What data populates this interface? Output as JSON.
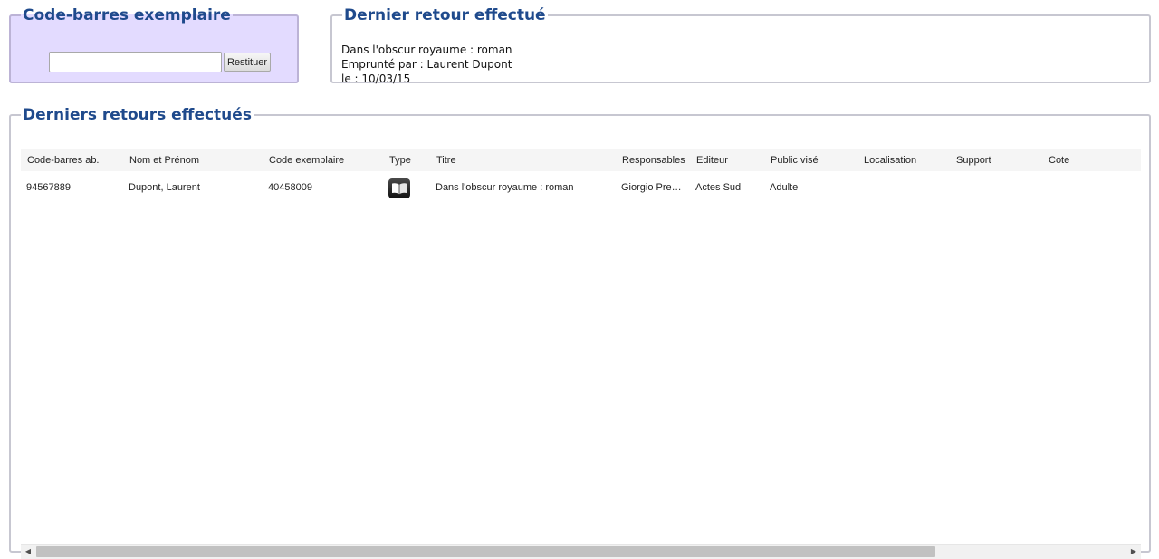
{
  "barcode_panel": {
    "legend": "Code-barres exemplaire",
    "input_value": "",
    "input_placeholder": "",
    "button_label": "Restituer"
  },
  "last_return": {
    "legend": "Dernier retour effectué",
    "lines": [
      "Dans l'obscur royaume : roman",
      "Emprunté par : Laurent Dupont",
      "le : 10/03/15"
    ]
  },
  "returns_list": {
    "legend": "Derniers retours effectués",
    "columns": [
      "Code-barres ab.",
      "Nom et Prénom",
      "Code exemplaire",
      "Type",
      "Titre",
      "Responsables",
      "Editeur",
      "Public visé",
      "Localisation",
      "Support",
      "Cote"
    ],
    "rows": [
      {
        "barcode": "94567889",
        "name": "Dupont, Laurent",
        "item_code": "40458009",
        "type_icon": "book-icon",
        "title": "Dans l'obscur royaume : roman",
        "authors": "Giorgio Pressburger",
        "publisher": "Actes Sud",
        "audience": "Adulte",
        "location": "",
        "support": "",
        "shelfmark": ""
      }
    ]
  },
  "colors": {
    "legend": "#1f4a8c",
    "barcode_panel_bg": "#e3dbff",
    "border": "#c7c7d1",
    "header_bg": "#f5f5f5"
  }
}
